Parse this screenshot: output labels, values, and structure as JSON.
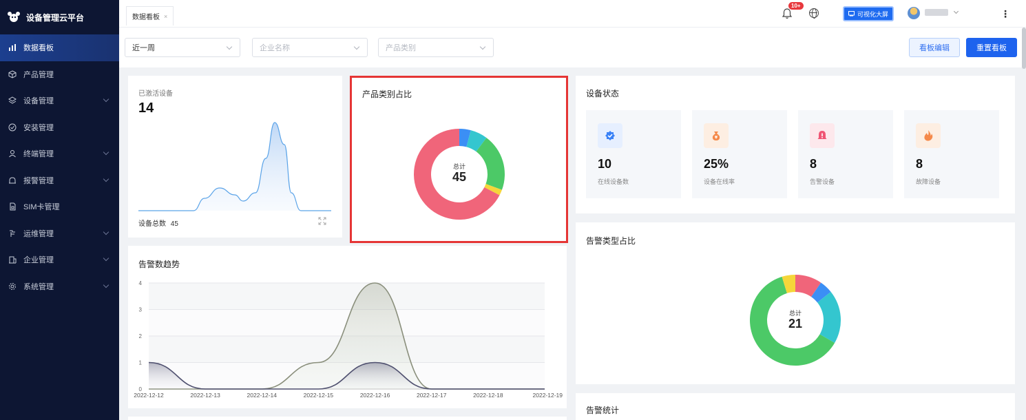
{
  "app": {
    "title": "设备管理云平台"
  },
  "sidebar": {
    "items": [
      {
        "label": "数据看板",
        "icon": "bar-chart-icon",
        "active": true,
        "expandable": false
      },
      {
        "label": "产品管理",
        "icon": "cube-icon",
        "active": false,
        "expandable": false
      },
      {
        "label": "设备管理",
        "icon": "layers-icon",
        "active": false,
        "expandable": true
      },
      {
        "label": "安装管理",
        "icon": "check-circle-icon",
        "active": false,
        "expandable": false
      },
      {
        "label": "终端管理",
        "icon": "user-icon",
        "active": false,
        "expandable": true
      },
      {
        "label": "报警管理",
        "icon": "alarm-icon",
        "active": false,
        "expandable": true
      },
      {
        "label": "SIM卡管理",
        "icon": "sim-card-icon",
        "active": false,
        "expandable": false
      },
      {
        "label": "运维管理",
        "icon": "tool-icon",
        "active": false,
        "expandable": true
      },
      {
        "label": "企业管理",
        "icon": "building-icon",
        "active": false,
        "expandable": true
      },
      {
        "label": "系统管理",
        "icon": "settings-icon",
        "active": false,
        "expandable": true
      }
    ]
  },
  "header": {
    "tab_label": "数据看板",
    "tab_close": "×",
    "notification_badge": "10+",
    "visual_screen_label": "可视化大屏",
    "more_icon": "⋮"
  },
  "filters": {
    "period": "近一周",
    "company_placeholder": "企业名称",
    "category_placeholder": "产品类别",
    "edit_label": "看板编辑",
    "reset_label": "重置看板"
  },
  "activated": {
    "label": "已激活设备",
    "value": "14",
    "total_label": "设备总数",
    "total_value": "45"
  },
  "product_category": {
    "title": "产品类别占比",
    "center_label": "总计",
    "center_value": "45",
    "colors": [
      "#f0657a",
      "#3b8ff5",
      "#34c6cf",
      "#4cc967",
      "#f5d63a"
    ],
    "values": [
      33,
      2,
      3,
      10,
      1
    ]
  },
  "device_status": {
    "title": "设备状态",
    "stats": [
      {
        "value": "10",
        "label": "在线设备数",
        "icon": "verified-icon",
        "color": "#3b82f6",
        "bg": "#e6efff"
      },
      {
        "value": "25%",
        "label": "设备在线率",
        "icon": "money-bag-icon",
        "color": "#f5894a",
        "bg": "#fdeee2"
      },
      {
        "value": "8",
        "label": "告警设备",
        "icon": "alert-bell-icon",
        "color": "#f05574",
        "bg": "#fde8ec"
      },
      {
        "value": "8",
        "label": "故障设备",
        "icon": "fire-icon",
        "color": "#f5894a",
        "bg": "#fdeee2"
      }
    ]
  },
  "alarm_type": {
    "title": "告警类型占比",
    "center_label": "总计",
    "center_value": "21",
    "colors": [
      "#f0657a",
      "#3b8ff5",
      "#34c6cf",
      "#4cc967",
      "#f5d63a"
    ],
    "values": [
      2,
      1,
      4,
      13,
      1
    ]
  },
  "alarm_trend": {
    "title": "告警数趋势",
    "y_ticks": [
      "4",
      "3",
      "2",
      "1",
      "0"
    ],
    "x_labels": [
      "2022-12-12",
      "2022-12-13",
      "2022-12-14",
      "2022-12-15",
      "2022-12-16",
      "2022-12-17",
      "2022-12-18",
      "2022-12-19"
    ]
  },
  "alarm_stats": {
    "title": "告警统计"
  },
  "chart_data": [
    {
      "type": "area",
      "title": "已激活设备",
      "x": [
        0,
        1,
        2,
        3,
        4,
        5,
        6,
        7
      ],
      "series": [
        {
          "values": [
            0,
            0,
            0,
            1.1,
            0.5,
            4.3,
            0,
            0
          ]
        }
      ]
    },
    {
      "type": "pie",
      "title": "产品类别占比",
      "total": 45,
      "values": [
        33,
        2,
        3,
        10,
        1
      ]
    },
    {
      "type": "pie",
      "title": "告警类型占比",
      "total": 21,
      "values": [
        2,
        1,
        4,
        13,
        1
      ]
    },
    {
      "type": "area",
      "title": "告警数趋势",
      "categories": [
        "2022-12-12",
        "2022-12-13",
        "2022-12-14",
        "2022-12-15",
        "2022-12-16",
        "2022-12-17",
        "2022-12-18",
        "2022-12-19"
      ],
      "ylim": [
        0,
        4
      ],
      "series": [
        {
          "values": [
            1,
            0,
            0,
            0,
            1,
            0,
            0,
            0
          ],
          "color": "#4e4f6e"
        },
        {
          "values": [
            0,
            0,
            0,
            1,
            4,
            0,
            0,
            0
          ],
          "color": "#8a8f7c"
        }
      ]
    }
  ]
}
